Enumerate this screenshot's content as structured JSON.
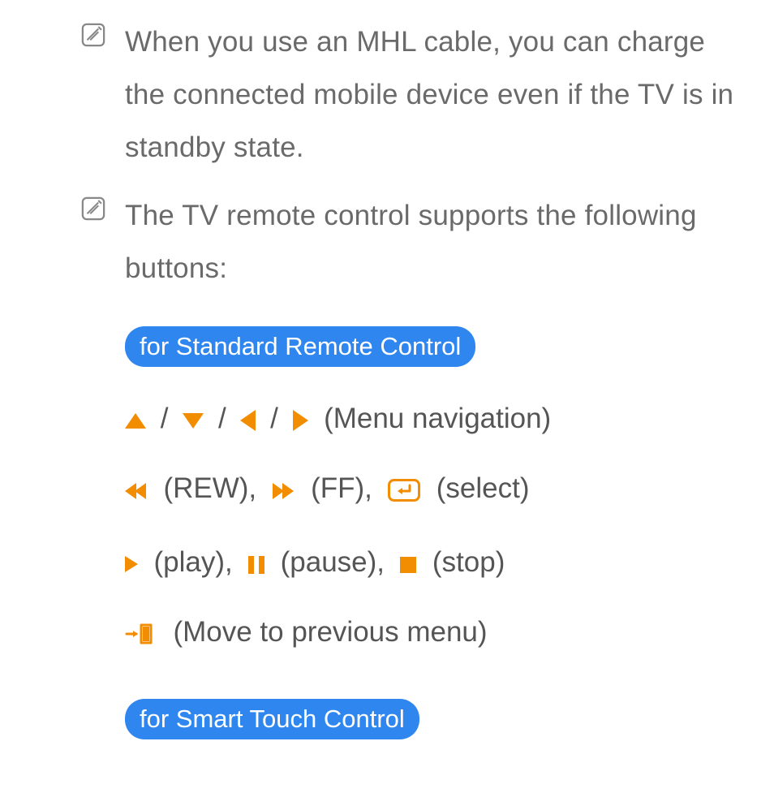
{
  "notes": [
    {
      "text": "When you use an MHL cable, you can charge the connected mobile device even if the TV is in standby state."
    },
    {
      "text": "The TV remote control supports the following buttons:"
    }
  ],
  "pill1": "for Standard Remote Control",
  "pill2": "for Smart Touch Control",
  "labels": {
    "menuNav": "(Menu navigation)",
    "rew": "(REW),",
    "ff": "(FF),",
    "select": "(select)",
    "play": "(play),",
    "pause": "(pause),",
    "stop": "(stop)",
    "prevMenu": "(Move to previous menu)"
  },
  "sep": "/"
}
